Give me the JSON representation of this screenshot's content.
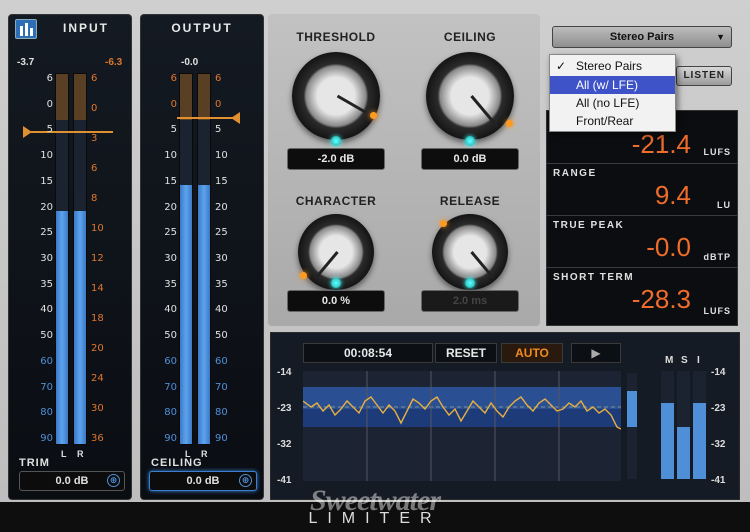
{
  "input": {
    "title": "INPUT",
    "peak_left": "-3.7",
    "peak_right": "-6.3",
    "scale_left": [
      "6",
      "0",
      "5",
      "10",
      "15",
      "20",
      "25",
      "30",
      "35",
      "40",
      "50",
      "60",
      "70",
      "80",
      "90"
    ],
    "scale_right": [
      "6",
      "0",
      "3",
      "6",
      "8",
      "10",
      "12",
      "14",
      "18",
      "20",
      "24",
      "30",
      "36"
    ],
    "channel_left": "L",
    "channel_right": "R",
    "level_left": 0.63,
    "level_right": 0.63,
    "trim_label": "TRIM",
    "trim_value": "0.0 dB"
  },
  "output": {
    "title": "OUTPUT",
    "peak": "-0.0",
    "scale_left": [
      "6",
      "0",
      "5",
      "10",
      "15",
      "20",
      "25",
      "30",
      "35",
      "40",
      "50",
      "60",
      "70",
      "80",
      "90"
    ],
    "scale_right": [
      "6",
      "0",
      "5",
      "10",
      "15",
      "20",
      "25",
      "30",
      "35",
      "40",
      "50",
      "60",
      "70",
      "80",
      "90"
    ],
    "channel_left": "L",
    "channel_right": "R",
    "level_left": 0.7,
    "level_right": 0.7,
    "ceiling_label": "CEILING",
    "ceiling_value": "0.0 dB"
  },
  "knobs": {
    "threshold": {
      "label": "THRESHOLD",
      "value": "-2.0 dB"
    },
    "ceiling": {
      "label": "CEILING",
      "value": "0.0 dB"
    },
    "character": {
      "label": "CHARACTER",
      "value": "0.0 %"
    },
    "release": {
      "label": "RELEASE",
      "value": "2.0 ms"
    }
  },
  "dropdown": {
    "selected": "Stereo Pairs",
    "options": [
      "Stereo Pairs",
      "All (w/ LFE)",
      "All (no LFE)",
      "Front/Rear"
    ],
    "checked_index": 0,
    "highlight_index": 1
  },
  "listen_label": "LISTEN",
  "loudness": [
    {
      "name": "",
      "value": "-21.4",
      "unit": "LUFS"
    },
    {
      "name": "RANGE",
      "value": "9.4",
      "unit": "LU"
    },
    {
      "name": "TRUE PEAK",
      "value": "-0.0",
      "unit": "dBTP"
    },
    {
      "name": "SHORT TERM",
      "value": "-28.3",
      "unit": "LUFS"
    }
  ],
  "history": {
    "time": "00:08:54",
    "reset_label": "RESET",
    "auto_label": "AUTO",
    "scale": [
      "-14",
      "-23",
      "-32",
      "-41"
    ],
    "msi_labels": [
      "M",
      "S",
      "I"
    ],
    "scale_right": [
      "-14",
      "-23",
      "-32",
      "-41"
    ]
  },
  "brand": "Sweetwater",
  "product": "LIMITER",
  "colors": {
    "accent_orange": "#f06c2a",
    "meter_blue": "#4f8fd8",
    "menu_highlight": "#3f53c8"
  }
}
